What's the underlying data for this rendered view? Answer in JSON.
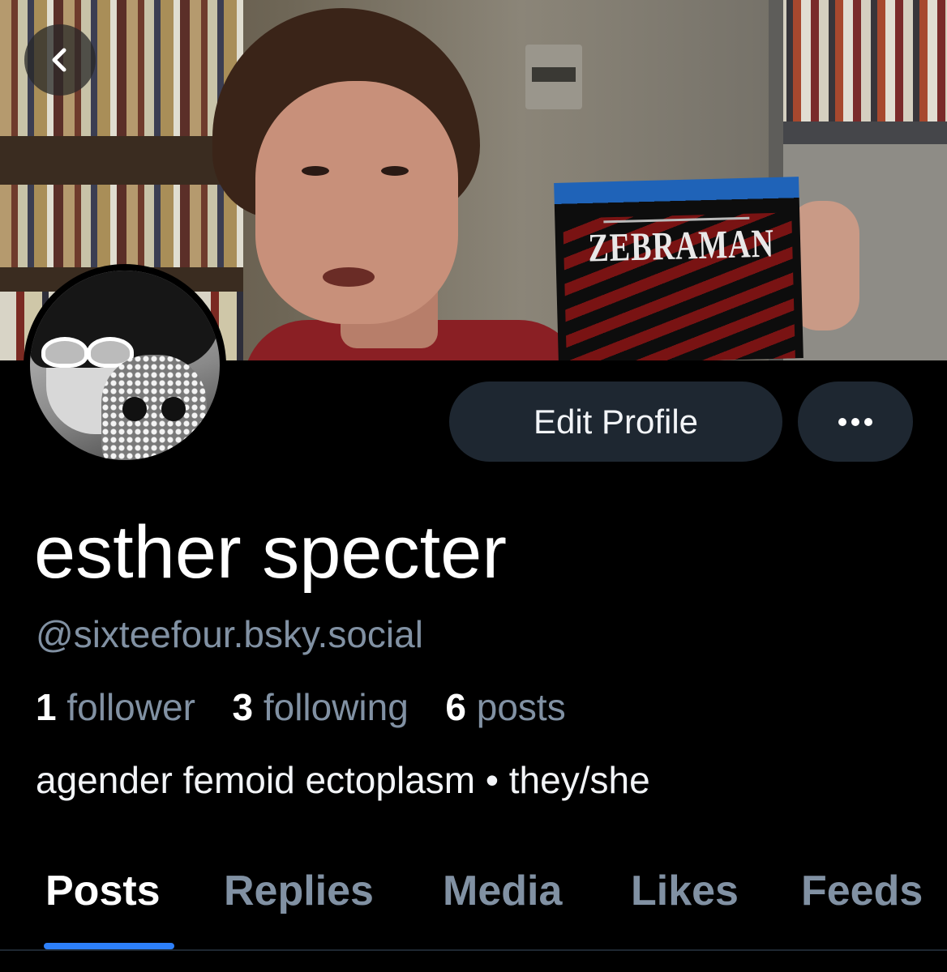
{
  "header": {
    "back_icon": "chevron-left-icon"
  },
  "banner": {
    "dvd_title": "ZEBRAMAN"
  },
  "actions": {
    "edit_label": "Edit Profile",
    "more_icon": "ellipsis-icon"
  },
  "profile": {
    "display_name": "esther specter",
    "handle": "@sixteefour.bsky.social",
    "followers_count": "1",
    "followers_label": "follower",
    "following_count": "3",
    "following_label": "following",
    "posts_count": "6",
    "posts_label": "posts",
    "bio": "agender femoid ectoplasm • they/she"
  },
  "tabs": [
    {
      "label": "Posts",
      "active": true
    },
    {
      "label": "Replies",
      "active": false
    },
    {
      "label": "Media",
      "active": false
    },
    {
      "label": "Likes",
      "active": false
    },
    {
      "label": "Feeds",
      "active": false
    }
  ],
  "colors": {
    "background": "#000000",
    "button_bg": "#1e2731",
    "muted_text": "#8191a3",
    "accent": "#2d7ff9"
  }
}
